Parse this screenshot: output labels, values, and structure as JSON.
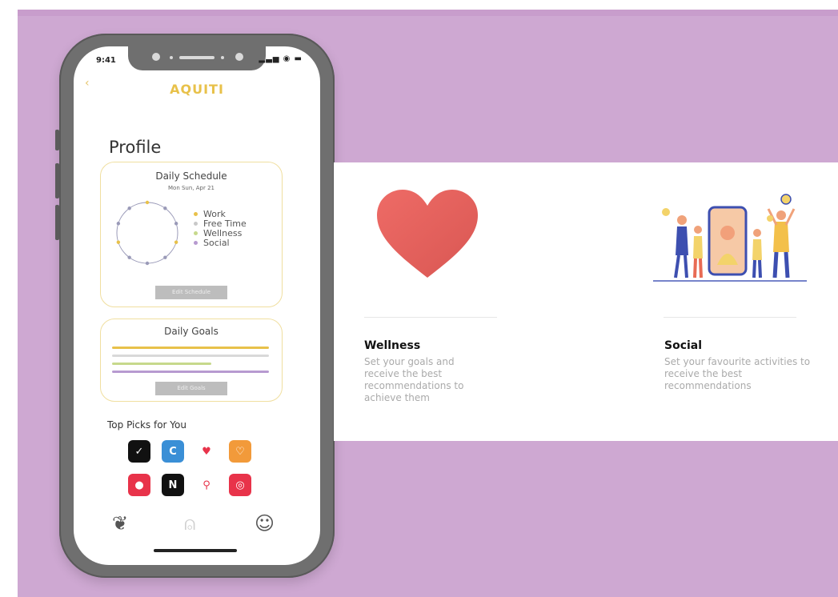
{
  "phone": {
    "status_time": "9:41",
    "status_icons": "▂▃▅ ◉ ▬",
    "back_icon": "back-chevron-icon",
    "app_name": "AQUITI",
    "profile_title": "Profile",
    "schedule": {
      "title": "Daily Schedule",
      "date": "Mon Sun, Apr 21",
      "legend": [
        {
          "label": "Work",
          "color": "#e8c14a"
        },
        {
          "label": "Free Time",
          "color": "#c9c9c9"
        },
        {
          "label": "Wellness",
          "color": "#c7d98c"
        },
        {
          "label": "Social",
          "color": "#b79ad0"
        }
      ],
      "button_label": "Edit Schedule"
    },
    "goals": {
      "title": "Daily Goals",
      "bars": [
        {
          "color": "#e8c14a",
          "fraction": 0.98
        },
        {
          "color": "#d9d9d9",
          "fraction": 0.98
        },
        {
          "color": "#c7d98c",
          "fraction": 0.62
        },
        {
          "color": "#b79ad0",
          "fraction": 0.98
        }
      ],
      "button_label": "Edit Goals"
    },
    "top_picks_title": "Top Picks for You",
    "apps": [
      {
        "name": "nike-app-icon",
        "bg": "#111111",
        "glyph": "✓"
      },
      {
        "name": "calm-app-icon",
        "bg": "#3a8fd6",
        "glyph": "C"
      },
      {
        "name": "heart-app-icon",
        "bg": "#ffffff",
        "glyph": "♥"
      },
      {
        "name": "wellness-app-icon",
        "bg": "#f29a3a",
        "glyph": "♡"
      },
      {
        "name": "headspace-app-icon",
        "bg": "#e8334a",
        "glyph": "●"
      },
      {
        "name": "netflix-app-icon",
        "bg": "#111111",
        "glyph": "N"
      },
      {
        "name": "maps-app-icon",
        "bg": "#ffffff",
        "glyph": "⚲"
      },
      {
        "name": "sports-app-icon",
        "bg": "#e8334a",
        "glyph": "◎"
      }
    ],
    "tabs": [
      {
        "name": "tab-wellness",
        "icon": "sprout-icon",
        "glyph": "❦"
      },
      {
        "name": "tab-profile",
        "icon": "person-icon",
        "glyph": "⍝"
      },
      {
        "name": "tab-social",
        "icon": "smiley-icon",
        "glyph": "☺"
      }
    ]
  },
  "features": [
    {
      "title": "Wellness",
      "description": "Set your goals and receive the best recommendations to achieve them",
      "illustration": "heart-illustration"
    },
    {
      "title": "Social",
      "description": "Set your favourite activities to receive the best recommendations",
      "illustration": "people-illustration"
    }
  ]
}
